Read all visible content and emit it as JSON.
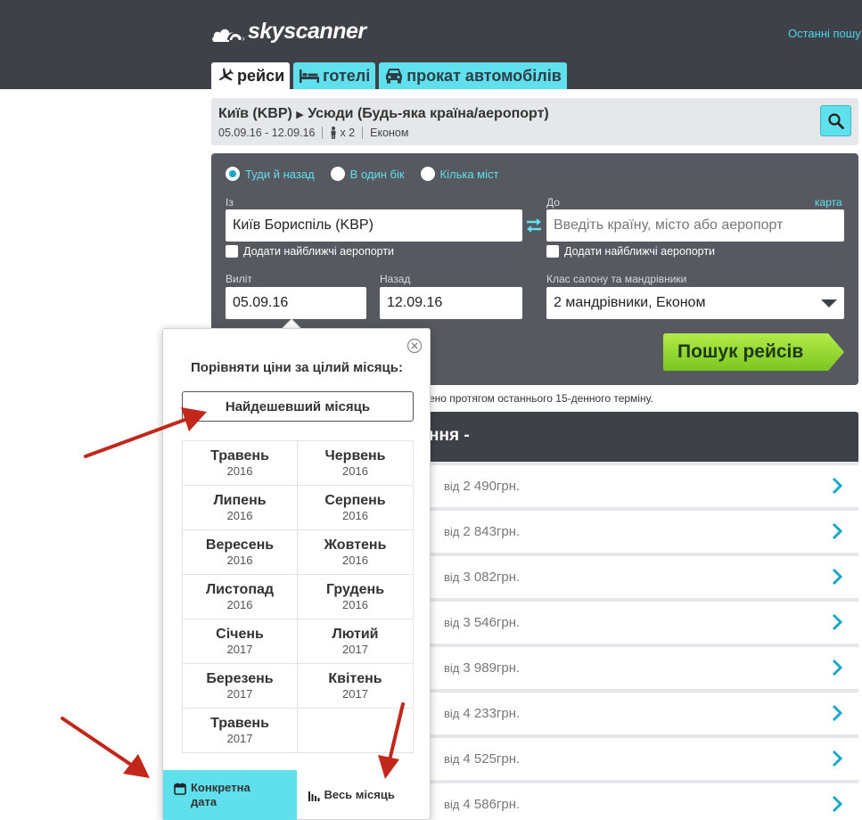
{
  "header": {
    "logo_text": "skyscanner",
    "recent_link": "Останні пошу",
    "tabs": [
      {
        "label": "рейси",
        "icon": "plane-icon",
        "active": true
      },
      {
        "label": "готелі",
        "icon": "bed-icon",
        "active": false
      },
      {
        "label": "прокат автомобілів",
        "icon": "car-icon",
        "active": false
      }
    ]
  },
  "summary": {
    "origin": "Київ (KBP)",
    "destination": "Усюди (Будь-яка країна/аеропорт)",
    "dates": "05.09.16 - 12.09.16",
    "travellers": "x 2",
    "cabin": "Економ"
  },
  "search_form": {
    "trip_types": [
      "Туди й назад",
      "В один бік",
      "Кілька міст"
    ],
    "selected_trip_type": "Туди й назад",
    "from_label": "Із",
    "from_value": "Київ Бориспіль (KBP)",
    "to_label": "До",
    "to_placeholder": "Введіть країну, місто або аеропорт",
    "map_link": "карта",
    "nearby_airports_label": "Додати найближчі аеропорти",
    "depart_label": "Виліт",
    "depart_value": "05.09.16",
    "return_label": "Назад",
    "return_value": "12.09.16",
    "cabin_label": "Клас салону та мандрівники",
    "cabin_value": "2 мандрівники, Економ",
    "submit_label": "Пошук рейсів"
  },
  "results": {
    "note": "ено протягом останнього 15-денного терміну.",
    "heading": "ння -",
    "price_prefix": "від",
    "prices": [
      "2 490грн.",
      "2 843грн.",
      "3 082грн.",
      "3 546грн.",
      "3 989грн.",
      "4 233грн.",
      "4 525грн.",
      "4 586грн."
    ]
  },
  "month_popup": {
    "title": "Порівняти ціни за цілий місяць:",
    "cheapest_label": "Найдешевший місяць",
    "months": [
      {
        "name": "Травень",
        "year": "2016"
      },
      {
        "name": "Червень",
        "year": "2016"
      },
      {
        "name": "Липень",
        "year": "2016"
      },
      {
        "name": "Серпень",
        "year": "2016"
      },
      {
        "name": "Вересень",
        "year": "2016"
      },
      {
        "name": "Жовтень",
        "year": "2016"
      },
      {
        "name": "Листопад",
        "year": "2016"
      },
      {
        "name": "Грудень",
        "year": "2016"
      },
      {
        "name": "Січень",
        "year": "2017"
      },
      {
        "name": "Лютий",
        "year": "2017"
      },
      {
        "name": "Березень",
        "year": "2017"
      },
      {
        "name": "Квітень",
        "year": "2017"
      },
      {
        "name": "Травень",
        "year": "2017"
      }
    ],
    "footer": {
      "specific_date_line1": "Конкретна",
      "specific_date_line2": "дата",
      "whole_month": "Весь місяць"
    }
  },
  "colors": {
    "header_bg": "#3e4148",
    "panel_bg": "#56595f",
    "accent_cyan": "#5fe0ec",
    "cta_green": "#8bd22b",
    "arrow_red": "#c1271a"
  }
}
